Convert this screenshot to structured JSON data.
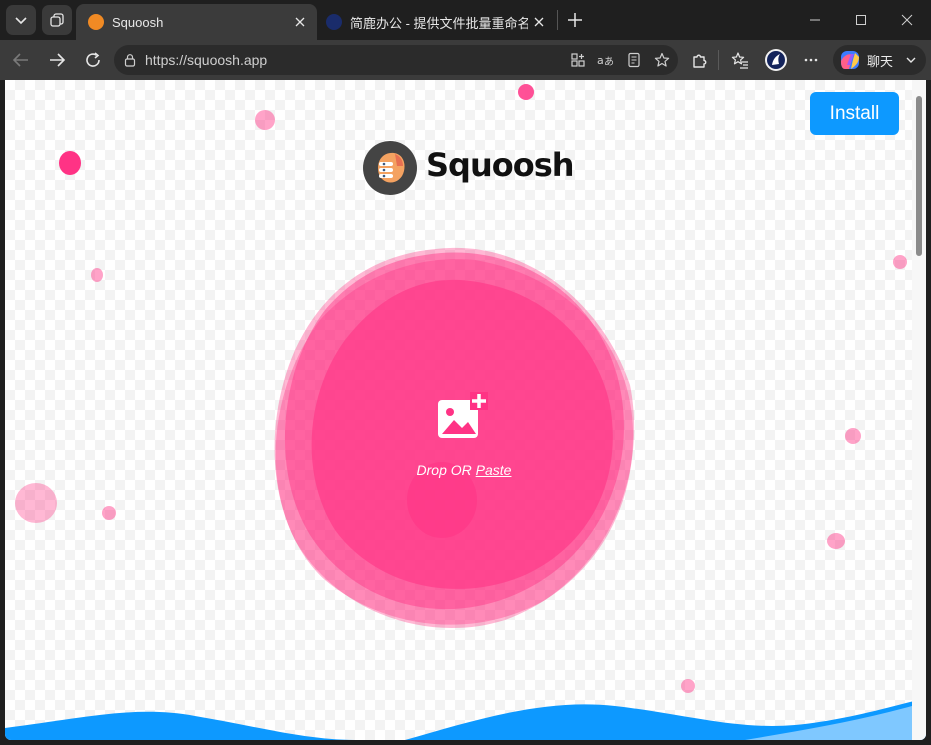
{
  "browser": {
    "tabs": [
      {
        "title": "Squoosh",
        "active": true
      },
      {
        "title": "简鹿办公 - 提供文件批量重命名、",
        "active": false
      }
    ],
    "url": "https://squoosh.app",
    "chat_label": "聊天",
    "icons": {
      "tab_actions": "chevron-down-icon",
      "workspaces": "workspaces-icon",
      "new_tab": "plus-icon",
      "minimize": "minimize-icon",
      "maximize": "maximize-icon",
      "close": "close-icon",
      "back": "arrow-left-icon",
      "forward": "arrow-right-icon",
      "refresh": "refresh-icon",
      "lock": "lock-icon",
      "app_available": "app-grid-icon",
      "translate": "translate-icon",
      "reader": "reader-icon",
      "favorite": "star-icon",
      "extensions": "puzzle-icon",
      "favorites_list": "favorites-icon",
      "profile": "profile-icon",
      "more": "ellipsis-icon",
      "copilot": "copilot-icon"
    }
  },
  "page": {
    "install_label": "Install",
    "logo_text": "Squoosh",
    "drop": {
      "prefix": "Drop OR ",
      "paste": "Paste"
    },
    "colors": {
      "accent_pink": "#ff3385",
      "install_blue": "#0d99ff",
      "wave_blue": "#0d99ff"
    }
  }
}
